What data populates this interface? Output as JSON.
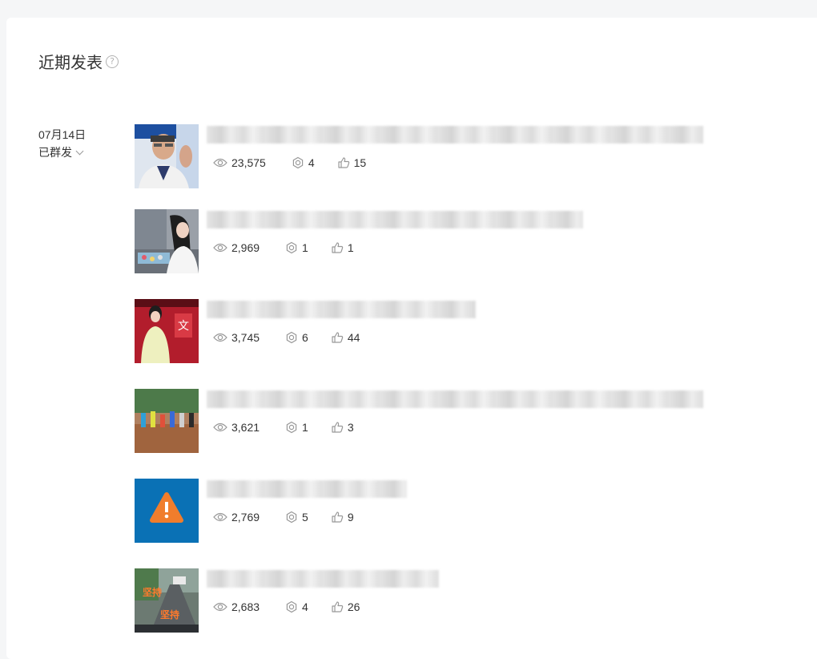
{
  "section": {
    "title": "近期发表",
    "help_icon": "question-circle-icon"
  },
  "group": {
    "date": "07月14日",
    "status": "已群发"
  },
  "articles": [
    {
      "thumb_desc": "man-in-glasses-press-conference",
      "views": "23,575",
      "shares": "4",
      "likes": "15",
      "title_blurred": true
    },
    {
      "thumb_desc": "woman-in-white-on-stage",
      "views": "2,969",
      "shares": "1",
      "likes": "1",
      "title_blurred": true
    },
    {
      "thumb_desc": "woman-in-yellow-on-red-stage",
      "views": "3,745",
      "shares": "6",
      "likes": "44",
      "title_blurred": true
    },
    {
      "thumb_desc": "flood-rescue-crowd",
      "views": "3,621",
      "shares": "1",
      "likes": "3",
      "title_blurred": true
    },
    {
      "thumb_desc": "orange-warning-triangle-on-blue",
      "views": "2,769",
      "shares": "5",
      "likes": "9",
      "title_blurred": true
    },
    {
      "thumb_desc": "road-with-overlay-text",
      "views": "2,683",
      "shares": "4",
      "likes": "26",
      "title_blurred": true,
      "thumb_text": "坚持"
    }
  ],
  "colors": {
    "warning_bg": "#0a71b5",
    "warning_triangle": "#f07d2c",
    "text": "#333333",
    "icon": "#999999"
  }
}
